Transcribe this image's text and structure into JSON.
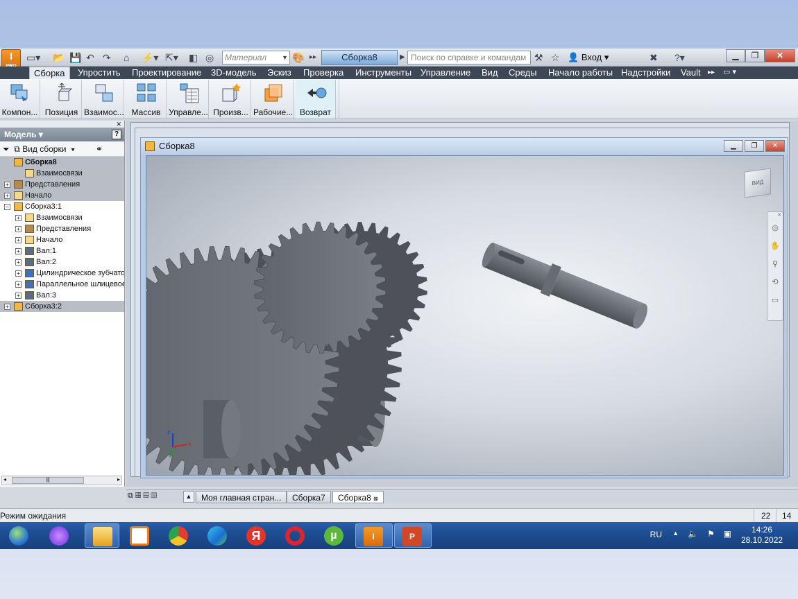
{
  "app": {
    "logo_text": "I",
    "logo_sub": "PRO",
    "material_placeholder": "Материал",
    "document_tab": "Сборка8",
    "help_search_placeholder": "Поиск по справке и командам",
    "login_label": "Вход"
  },
  "ribbon_tabs": [
    {
      "label": "Сборка",
      "active": true
    },
    {
      "label": "Упростить"
    },
    {
      "label": "Проектирование"
    },
    {
      "label": "3D-модель"
    },
    {
      "label": "Эскиз"
    },
    {
      "label": "Проверка"
    },
    {
      "label": "Инструменты"
    },
    {
      "label": "Управление"
    },
    {
      "label": "Вид"
    },
    {
      "label": "Среды"
    },
    {
      "label": "Начало работы"
    },
    {
      "label": "Надстройки"
    },
    {
      "label": "Vault"
    }
  ],
  "ribbon_buttons": [
    {
      "label": "Компон...",
      "icon": "place-component-icon"
    },
    {
      "label": "Позиция",
      "icon": "position-move-icon"
    },
    {
      "label": "Взаимос...",
      "icon": "constraint-icon"
    },
    {
      "label": "Массив",
      "icon": "pattern-icon"
    },
    {
      "label": "Управле...",
      "icon": "manage-bom-icon"
    },
    {
      "label": "Произв...",
      "icon": "productivity-icon"
    },
    {
      "label": "Рабочие...",
      "icon": "work-features-icon"
    },
    {
      "label": "Возврат",
      "icon": "return-icon",
      "active": true
    }
  ],
  "browser": {
    "title": "Модель",
    "view_label": "Вид сборки",
    "tree": [
      {
        "label": "Сборка8",
        "level": 0,
        "bold": true,
        "expander": "",
        "icon": "assembly-icon",
        "selected": true
      },
      {
        "label": "Взаимосвязи",
        "level": 1,
        "expander": "",
        "icon": "folder-icon",
        "selected": true
      },
      {
        "label": "Представления",
        "level": 0,
        "expander": "+",
        "icon": "representations-icon",
        "selected": true
      },
      {
        "label": "Начало",
        "level": 0,
        "expander": "+",
        "icon": "folder-icon",
        "selected": true
      },
      {
        "label": "Сборка3:1",
        "level": 0,
        "expander": "-",
        "icon": "assembly-icon"
      },
      {
        "label": "Взаимосвязи",
        "level": 1,
        "expander": "+",
        "icon": "folder-icon"
      },
      {
        "label": "Представления",
        "level": 1,
        "expander": "+",
        "icon": "representations-icon"
      },
      {
        "label": "Начало",
        "level": 1,
        "expander": "+",
        "icon": "folder-icon"
      },
      {
        "label": "Вал:1",
        "level": 1,
        "expander": "+",
        "icon": "part-icon"
      },
      {
        "label": "Вал:2",
        "level": 1,
        "expander": "+",
        "icon": "part-icon"
      },
      {
        "label": "Цилиндрическое зубчатое",
        "level": 1,
        "expander": "+",
        "icon": "gear-icon"
      },
      {
        "label": "Параллельное шлицевое с",
        "level": 1,
        "expander": "+",
        "icon": "spline-icon"
      },
      {
        "label": "Вал:3",
        "level": 1,
        "expander": "+",
        "icon": "part-icon"
      },
      {
        "label": "Сборка3:2",
        "level": 0,
        "expander": "+",
        "icon": "assembly-icon",
        "selected": true
      }
    ]
  },
  "document_window": {
    "title": "Сборка8",
    "viewcube_label": "ВИД"
  },
  "doc_tabs": [
    {
      "label": "Моя главная стран..."
    },
    {
      "label": "Сборка7"
    },
    {
      "label": "Сборка8",
      "active": true
    }
  ],
  "status": {
    "text": "Режим ожидания",
    "count_a": "22",
    "count_b": "14"
  },
  "taskbar": {
    "language": "RU",
    "time": "14:26",
    "date": "28.10.2022",
    "apps": [
      "start-orb-icon",
      "alice-icon",
      "explorer-icon",
      "media-player-icon",
      "chrome-icon",
      "edge-icon",
      "yandex-icon",
      "opera-icon",
      "utorrent-icon",
      "inventor-icon",
      "powerpoint-icon"
    ]
  }
}
